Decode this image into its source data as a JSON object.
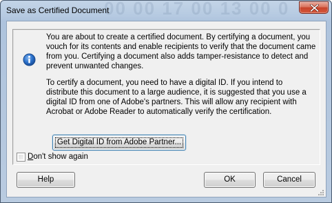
{
  "window": {
    "title": "Save as Certified Document",
    "background_text": "00 00 17 00 13 00 0"
  },
  "titlebar": {
    "close_icon": "close-icon"
  },
  "content": {
    "icon": "info-icon",
    "paragraph1": "You are about to create a certified document. By certifying a document, you vouch for its contents and enable recipients to verify that the document came from you. Certifying a document also adds tamper-resistance to detect and prevent unwanted changes.",
    "paragraph2": "To certify a document, you need to have a digital ID. If you intend to distribute this document to a large audience, it is suggested that you use a digital ID from one of Adobe's partners. This will allow any recipient with Acrobat or Adobe Reader to automatically verify the certification.",
    "get_id_button": "Get Digital ID from Adobe Partner..."
  },
  "options": {
    "dont_show_mnemonic": "D",
    "dont_show_rest": "on't show again",
    "dont_show_checked": false
  },
  "buttons": {
    "help": "Help",
    "ok": "OK",
    "cancel": "Cancel"
  },
  "colors": {
    "title_bar": "#b9cbe0",
    "close_button": "#c7432b",
    "info_icon": "#2a6fc9",
    "dialog_face": "#f0f0f0"
  }
}
